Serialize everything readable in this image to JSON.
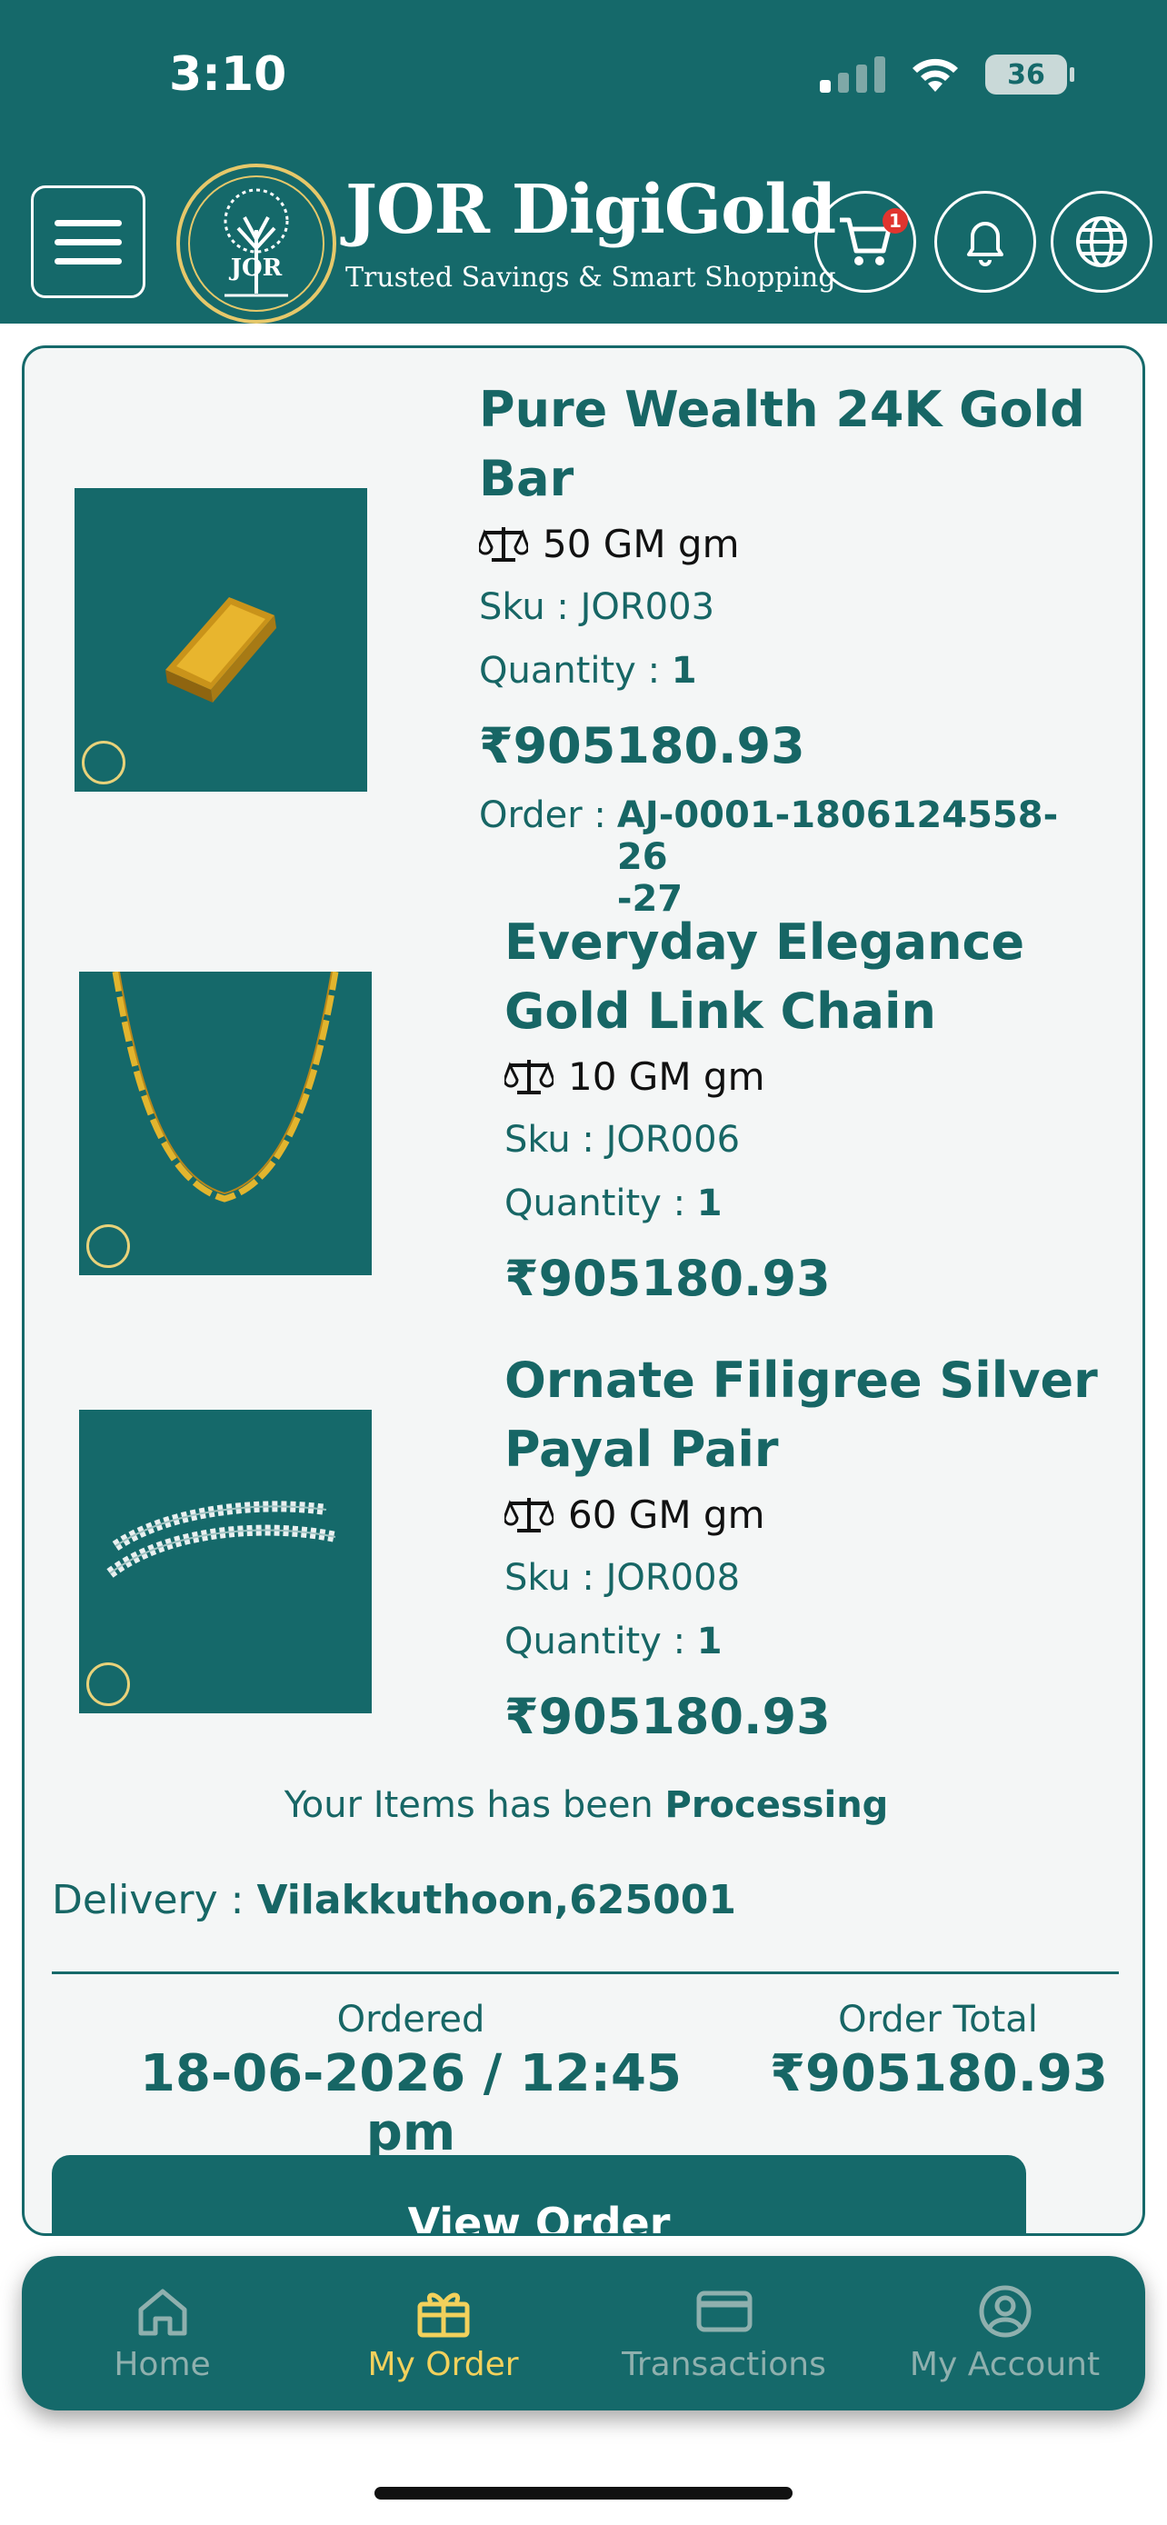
{
  "status_bar": {
    "time": "3:10",
    "battery": "36"
  },
  "header": {
    "brand_name": "JOR DigiGold",
    "tagline": "Trusted Savings & Smart Shopping",
    "logo_text": "JOR",
    "cart_count": "1",
    "icons": [
      "menu-icon",
      "cart-icon",
      "bell-icon",
      "globe-icon"
    ]
  },
  "items": [
    {
      "title_line1": "Pure Wealth 24K Gold",
      "title_line2": "Bar",
      "weight": "50 GM gm",
      "sku_label": "Sku : ",
      "sku": "JOR003",
      "qty_label": "Quantity : ",
      "qty": "1",
      "price": "₹905180.93"
    },
    {
      "title_line1": "Everyday Elegance",
      "title_line2": "Gold Link Chain",
      "weight": "10 GM gm",
      "sku_label": "Sku : ",
      "sku": "JOR006",
      "qty_label": "Quantity : ",
      "qty": "1",
      "price": "₹905180.93"
    },
    {
      "title_line1": "Ornate Filigree Silver",
      "title_line2": "Payal Pair",
      "weight": "60 GM gm",
      "sku_label": "Sku : ",
      "sku": "JOR008",
      "qty_label": "Quantity : ",
      "qty": "1",
      "price": "₹905180.93"
    }
  ],
  "order": {
    "label": "Order :",
    "number_line1": "AJ-0001-1806124558-26",
    "number_line2": "-27",
    "status_prefix": "Your Items has been ",
    "status": "Processing",
    "delivery_label": "Delivery : ",
    "delivery": "Vilakkuthoon,625001",
    "ordered_label": "Ordered",
    "ordered_value": "18-06-2026 / 12:45 pm",
    "total_label": "Order Total",
    "total_value": "₹905180.93",
    "view_button": "View Order"
  },
  "nav": [
    {
      "label": "Home",
      "icon": "home-icon",
      "active": false
    },
    {
      "label": "My Order",
      "icon": "gift-icon",
      "active": true
    },
    {
      "label": "Transactions",
      "icon": "card-icon",
      "active": false
    },
    {
      "label": "My Account",
      "icon": "account-icon",
      "active": false
    }
  ],
  "colors": {
    "primary": "#15696a",
    "accent": "#f2d15c",
    "badge": "#e0352f",
    "gold": "#e6c86a"
  }
}
